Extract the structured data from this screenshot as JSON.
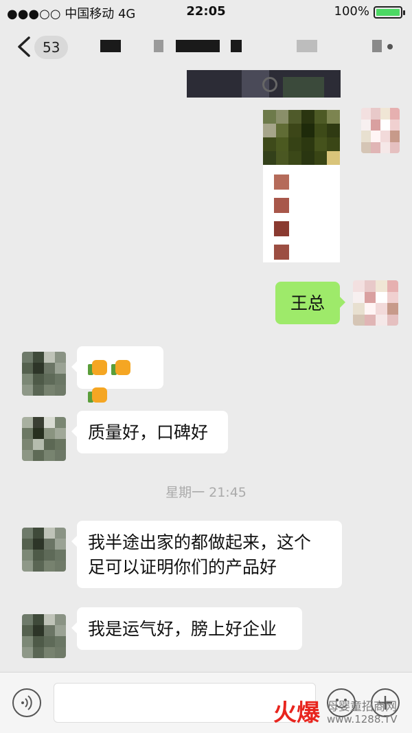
{
  "status_bar": {
    "carrier": "●●●○○ 中国移动   4G",
    "time": "22:05",
    "battery": "100%",
    "battery_level": 1.0
  },
  "nav": {
    "unread_count": "53"
  },
  "messages": [
    {
      "side": "right",
      "type": "image"
    },
    {
      "side": "right",
      "type": "text",
      "text": "王总"
    },
    {
      "side": "left",
      "type": "emoji",
      "emoji": "👍👍👍"
    },
    {
      "side": "left",
      "type": "text",
      "text": "质量好，口碑好"
    },
    {
      "side": "left",
      "type": "text",
      "lines": [
        "我半途出家的都做起来，这个",
        "足可以证明你们的产品好"
      ]
    },
    {
      "side": "left",
      "type": "text",
      "text": "我是运气好，膀上好企业"
    }
  ],
  "timestamp": "星期一 21:45",
  "watermark": {
    "brand": "火爆",
    "tagline": "母婴童招商网",
    "url": "www.1288.TV"
  },
  "colors": {
    "background": "#ebebeb",
    "outgoing_bubble": "#9eea6a",
    "incoming_bubble": "#ffffff",
    "watermark_red": "#e8251e"
  },
  "icons": [
    "back-chevron-icon",
    "voice-icon",
    "emoji-icon",
    "plus-icon",
    "thumbs-up-icon"
  ]
}
